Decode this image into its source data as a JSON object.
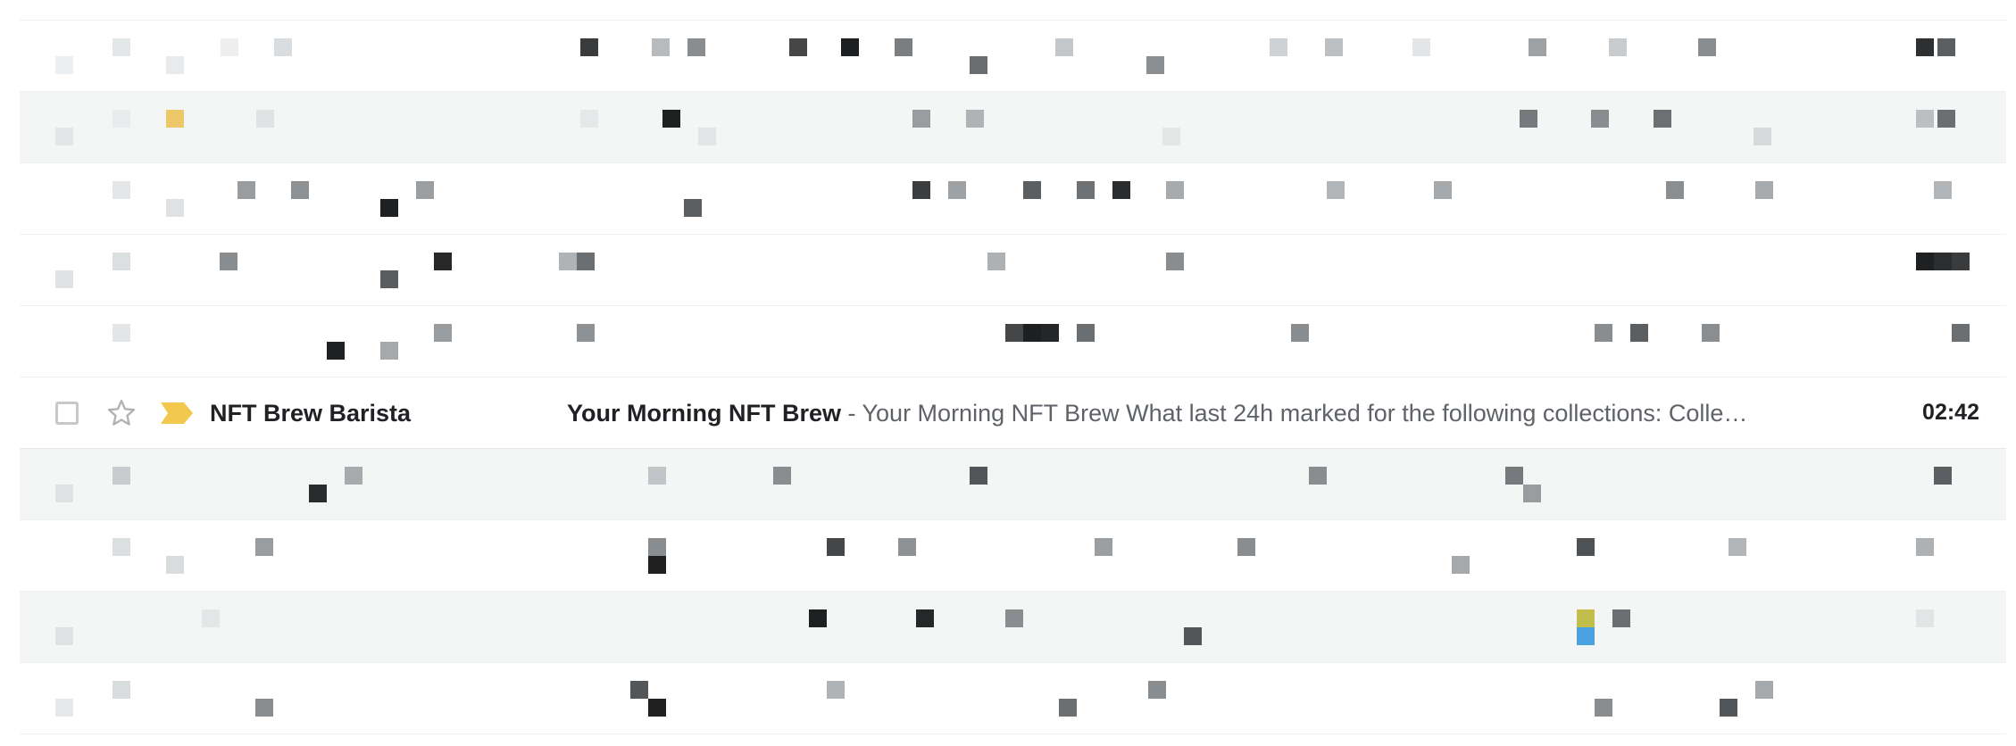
{
  "inbox": {
    "focused_row": {
      "sender": "NFT Brew Barista",
      "subject": "Your Morning NFT Brew",
      "separator": " - ",
      "snippet": "Your Morning NFT Brew What last 24h marked for the following collections: Colle…",
      "time": "02:42",
      "important_color": "#f2c94c",
      "checkbox_icon": "checkbox-icon",
      "star_icon": "star-icon",
      "importance_icon": "importance-marker-icon"
    },
    "blurred_rows_count": 9
  }
}
